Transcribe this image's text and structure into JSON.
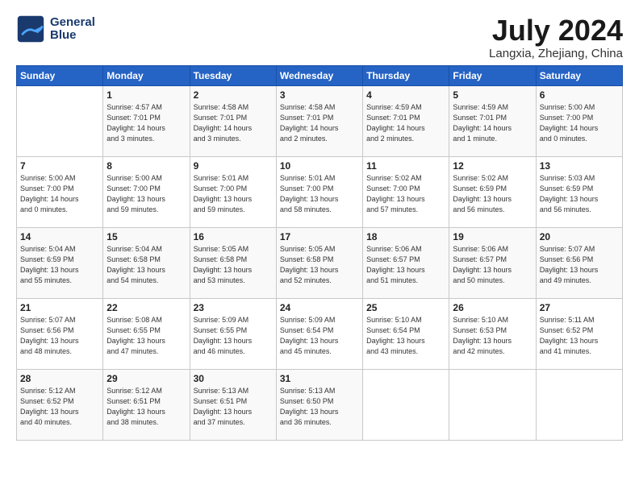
{
  "logo": {
    "line1": "General",
    "line2": "Blue"
  },
  "title": "July 2024",
  "subtitle": "Langxia, Zhejiang, China",
  "days_of_week": [
    "Sunday",
    "Monday",
    "Tuesday",
    "Wednesday",
    "Thursday",
    "Friday",
    "Saturday"
  ],
  "weeks": [
    [
      {
        "day": "",
        "info": ""
      },
      {
        "day": "1",
        "info": "Sunrise: 4:57 AM\nSunset: 7:01 PM\nDaylight: 14 hours\nand 3 minutes."
      },
      {
        "day": "2",
        "info": "Sunrise: 4:58 AM\nSunset: 7:01 PM\nDaylight: 14 hours\nand 3 minutes."
      },
      {
        "day": "3",
        "info": "Sunrise: 4:58 AM\nSunset: 7:01 PM\nDaylight: 14 hours\nand 2 minutes."
      },
      {
        "day": "4",
        "info": "Sunrise: 4:59 AM\nSunset: 7:01 PM\nDaylight: 14 hours\nand 2 minutes."
      },
      {
        "day": "5",
        "info": "Sunrise: 4:59 AM\nSunset: 7:01 PM\nDaylight: 14 hours\nand 1 minute."
      },
      {
        "day": "6",
        "info": "Sunrise: 5:00 AM\nSunset: 7:00 PM\nDaylight: 14 hours\nand 0 minutes."
      }
    ],
    [
      {
        "day": "7",
        "info": "Sunrise: 5:00 AM\nSunset: 7:00 PM\nDaylight: 14 hours\nand 0 minutes."
      },
      {
        "day": "8",
        "info": "Sunrise: 5:00 AM\nSunset: 7:00 PM\nDaylight: 13 hours\nand 59 minutes."
      },
      {
        "day": "9",
        "info": "Sunrise: 5:01 AM\nSunset: 7:00 PM\nDaylight: 13 hours\nand 59 minutes."
      },
      {
        "day": "10",
        "info": "Sunrise: 5:01 AM\nSunset: 7:00 PM\nDaylight: 13 hours\nand 58 minutes."
      },
      {
        "day": "11",
        "info": "Sunrise: 5:02 AM\nSunset: 7:00 PM\nDaylight: 13 hours\nand 57 minutes."
      },
      {
        "day": "12",
        "info": "Sunrise: 5:02 AM\nSunset: 6:59 PM\nDaylight: 13 hours\nand 56 minutes."
      },
      {
        "day": "13",
        "info": "Sunrise: 5:03 AM\nSunset: 6:59 PM\nDaylight: 13 hours\nand 56 minutes."
      }
    ],
    [
      {
        "day": "14",
        "info": "Sunrise: 5:04 AM\nSunset: 6:59 PM\nDaylight: 13 hours\nand 55 minutes."
      },
      {
        "day": "15",
        "info": "Sunrise: 5:04 AM\nSunset: 6:58 PM\nDaylight: 13 hours\nand 54 minutes."
      },
      {
        "day": "16",
        "info": "Sunrise: 5:05 AM\nSunset: 6:58 PM\nDaylight: 13 hours\nand 53 minutes."
      },
      {
        "day": "17",
        "info": "Sunrise: 5:05 AM\nSunset: 6:58 PM\nDaylight: 13 hours\nand 52 minutes."
      },
      {
        "day": "18",
        "info": "Sunrise: 5:06 AM\nSunset: 6:57 PM\nDaylight: 13 hours\nand 51 minutes."
      },
      {
        "day": "19",
        "info": "Sunrise: 5:06 AM\nSunset: 6:57 PM\nDaylight: 13 hours\nand 50 minutes."
      },
      {
        "day": "20",
        "info": "Sunrise: 5:07 AM\nSunset: 6:56 PM\nDaylight: 13 hours\nand 49 minutes."
      }
    ],
    [
      {
        "day": "21",
        "info": "Sunrise: 5:07 AM\nSunset: 6:56 PM\nDaylight: 13 hours\nand 48 minutes."
      },
      {
        "day": "22",
        "info": "Sunrise: 5:08 AM\nSunset: 6:55 PM\nDaylight: 13 hours\nand 47 minutes."
      },
      {
        "day": "23",
        "info": "Sunrise: 5:09 AM\nSunset: 6:55 PM\nDaylight: 13 hours\nand 46 minutes."
      },
      {
        "day": "24",
        "info": "Sunrise: 5:09 AM\nSunset: 6:54 PM\nDaylight: 13 hours\nand 45 minutes."
      },
      {
        "day": "25",
        "info": "Sunrise: 5:10 AM\nSunset: 6:54 PM\nDaylight: 13 hours\nand 43 minutes."
      },
      {
        "day": "26",
        "info": "Sunrise: 5:10 AM\nSunset: 6:53 PM\nDaylight: 13 hours\nand 42 minutes."
      },
      {
        "day": "27",
        "info": "Sunrise: 5:11 AM\nSunset: 6:52 PM\nDaylight: 13 hours\nand 41 minutes."
      }
    ],
    [
      {
        "day": "28",
        "info": "Sunrise: 5:12 AM\nSunset: 6:52 PM\nDaylight: 13 hours\nand 40 minutes."
      },
      {
        "day": "29",
        "info": "Sunrise: 5:12 AM\nSunset: 6:51 PM\nDaylight: 13 hours\nand 38 minutes."
      },
      {
        "day": "30",
        "info": "Sunrise: 5:13 AM\nSunset: 6:51 PM\nDaylight: 13 hours\nand 37 minutes."
      },
      {
        "day": "31",
        "info": "Sunrise: 5:13 AM\nSunset: 6:50 PM\nDaylight: 13 hours\nand 36 minutes."
      },
      {
        "day": "",
        "info": ""
      },
      {
        "day": "",
        "info": ""
      },
      {
        "day": "",
        "info": ""
      }
    ]
  ]
}
